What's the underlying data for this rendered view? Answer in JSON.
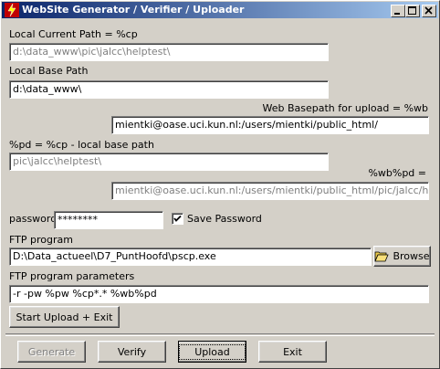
{
  "window": {
    "title": "WebSite  Generator / Verifier / Uploader",
    "icon": "flash-app-icon"
  },
  "fields": {
    "local_current_path": {
      "label": "Local Current Path = %cp",
      "value": "d:\\data_www\\pic\\jalcc\\helptest\\"
    },
    "local_base_path": {
      "label": "Local Base Path",
      "value": "d:\\data_www\\"
    },
    "web_basepath": {
      "label": "Web Basepath for upload = %wb",
      "value": "mientki@oase.uci.kun.nl:/users/mientki/public_html/"
    },
    "pd": {
      "label": "%pd = %cp - local base path",
      "value": "pic\\jalcc\\helptest\\"
    },
    "wbpd": {
      "label": "%wb%pd =",
      "value": "mientki@oase.uci.kun.nl:/users/mientki/public_html/pic/jalcc/helptest/"
    },
    "password": {
      "label": "password",
      "value": "********"
    },
    "save_password": {
      "label": "Save Password",
      "checked": true
    },
    "ftp_program": {
      "label": "FTP program",
      "value": "D:\\Data_actueel\\D7_PuntHoofd\\pscp.exe"
    },
    "ftp_params": {
      "label": "FTP program parameters",
      "value": "-r   -pw %pw   %cp*.*  %wb%pd"
    }
  },
  "buttons": {
    "browse": "Browse",
    "start_upload": "Start Upload + Exit",
    "generate": "Generate",
    "verify": "Verify",
    "upload": "Upload",
    "exit": "Exit"
  }
}
